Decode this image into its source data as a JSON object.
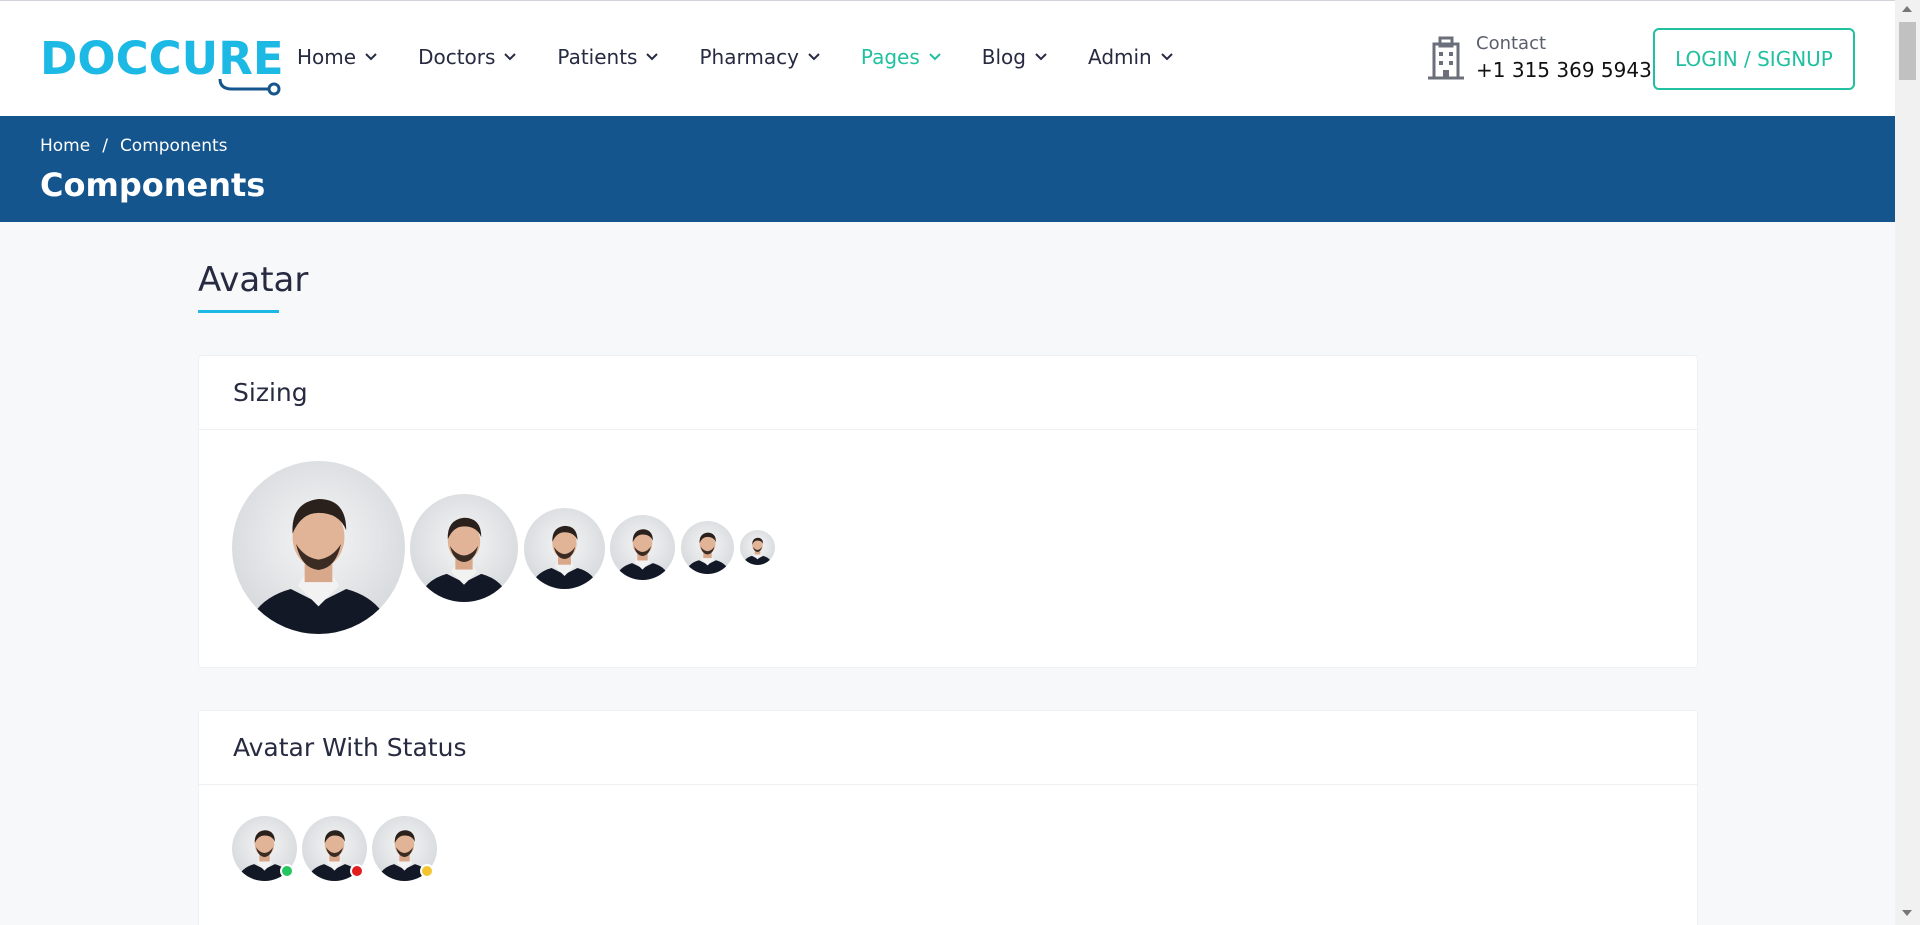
{
  "logo": {
    "text_a": "DOCC",
    "text_b": "URE"
  },
  "nav": [
    {
      "label": "Home",
      "active": false
    },
    {
      "label": "Doctors",
      "active": false
    },
    {
      "label": "Patients",
      "active": false
    },
    {
      "label": "Pharmacy",
      "active": false
    },
    {
      "label": "Pages",
      "active": true
    },
    {
      "label": "Blog",
      "active": false
    },
    {
      "label": "Admin",
      "active": false
    }
  ],
  "contact": {
    "label": "Contact",
    "phone": "+1 315 369 5943"
  },
  "login": {
    "label": "LOGIN / SIGNUP"
  },
  "breadcrumb": {
    "home": "Home",
    "separator": "/",
    "current": "Components"
  },
  "page_title": "Components",
  "section": {
    "title": "Avatar"
  },
  "cards": {
    "sizing": {
      "title": "Sizing"
    },
    "status": {
      "title": "Avatar With Status",
      "statuses": [
        "online",
        "offline",
        "away"
      ]
    }
  },
  "colors": {
    "accent": "#20c0a0",
    "logo": "#1db9e5",
    "banner": "#15558d",
    "online": "#22c55e",
    "offline": "#e11d1d",
    "away": "#f4c430"
  }
}
